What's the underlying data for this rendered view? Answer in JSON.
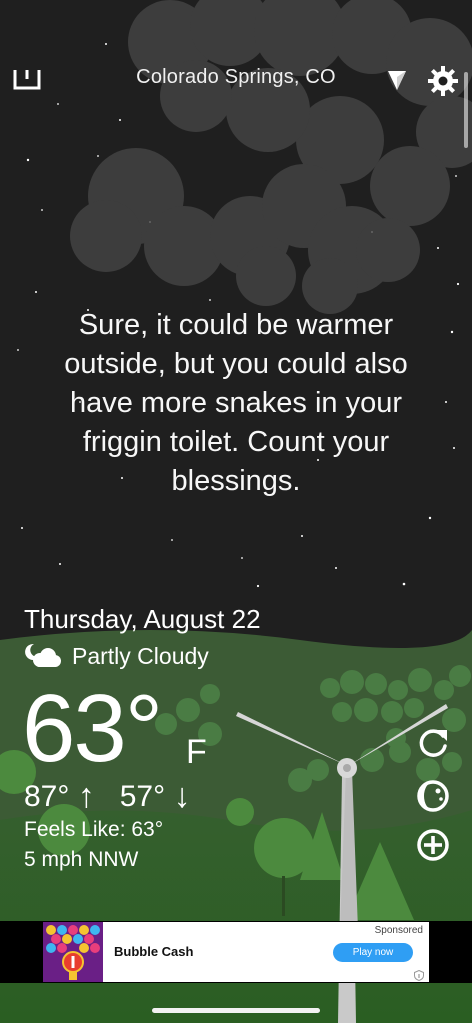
{
  "header": {
    "location": "Colorado Springs, CO"
  },
  "icons": {
    "menu": "menu-icon",
    "location": "location-arrow-icon",
    "settings": "gear-icon",
    "condition": "partly-cloudy-night-icon",
    "refresh": "refresh-icon",
    "theme": "theme-icon",
    "add": "add-icon",
    "ad_info": "info-icon"
  },
  "quote": "Sure, it could be warmer outside, but you could also have more snakes in your friggin toilet. Count your blessings.",
  "weather": {
    "date": "Thursday, August 22",
    "condition": "Partly Cloudy",
    "temperature": "63°",
    "unit": "F",
    "high": "87°",
    "low": "57°",
    "high_arrow": "↑",
    "low_arrow": "↓",
    "feels_like": "Feels Like: 63°",
    "wind": "5 mph NNW"
  },
  "ad": {
    "title": "Bubble Cash",
    "sponsored": "Sponsored",
    "cta": "Play now"
  },
  "colors": {
    "sky": "#1f1f1f",
    "hills": "#3c6f2f",
    "accent": "#2f9ef4"
  }
}
